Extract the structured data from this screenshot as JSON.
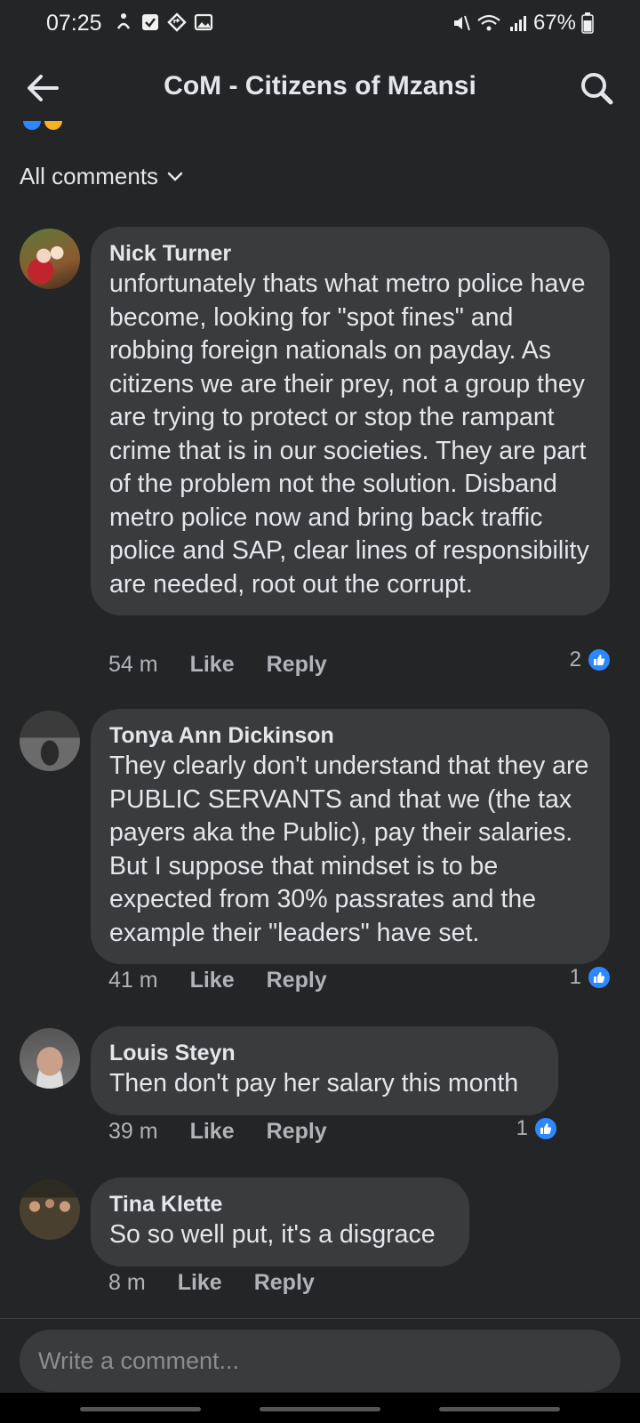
{
  "status": {
    "time": "07:25",
    "battery": "67%"
  },
  "header": {
    "title": "CoM - Citizens of Mzansi"
  },
  "filter": {
    "label": "All comments"
  },
  "comments": [
    {
      "author": "Nick Turner",
      "text": "unfortunately thats what metro police have become, looking for \"spot fines\" and robbing foreign nationals on payday. As citizens we are their prey, not a group they are trying to protect or stop the rampant crime that is in our societies. They are part of the problem not the solution. Disband metro police now and bring back traffic police and SAP, clear lines of responsibility are needed, root out the corrupt.",
      "time": "54 m",
      "like_label": "Like",
      "reply_label": "Reply",
      "likes": "2"
    },
    {
      "author": "Tonya Ann Dickinson",
      "text": "They clearly don't understand that they are PUBLIC SERVANTS and that we (the tax payers aka the Public), pay their salaries. But I suppose that mindset is to be expected from 30% passrates and the example their \"leaders\" have set.",
      "time": "41 m",
      "like_label": "Like",
      "reply_label": "Reply",
      "likes": "1"
    },
    {
      "author": "Louis Steyn",
      "text": "Then don't pay her salary this month",
      "time": "39 m",
      "like_label": "Like",
      "reply_label": "Reply",
      "likes": "1"
    },
    {
      "author": "Tina Klette",
      "text": "So so well put, it's a disgrace",
      "time": "8 m",
      "like_label": "Like",
      "reply_label": "Reply"
    }
  ],
  "composer": {
    "placeholder": "Write a comment..."
  },
  "colors": {
    "background": "#242526",
    "bubble": "#3a3b3c",
    "like_blue": "#2d88ff"
  }
}
